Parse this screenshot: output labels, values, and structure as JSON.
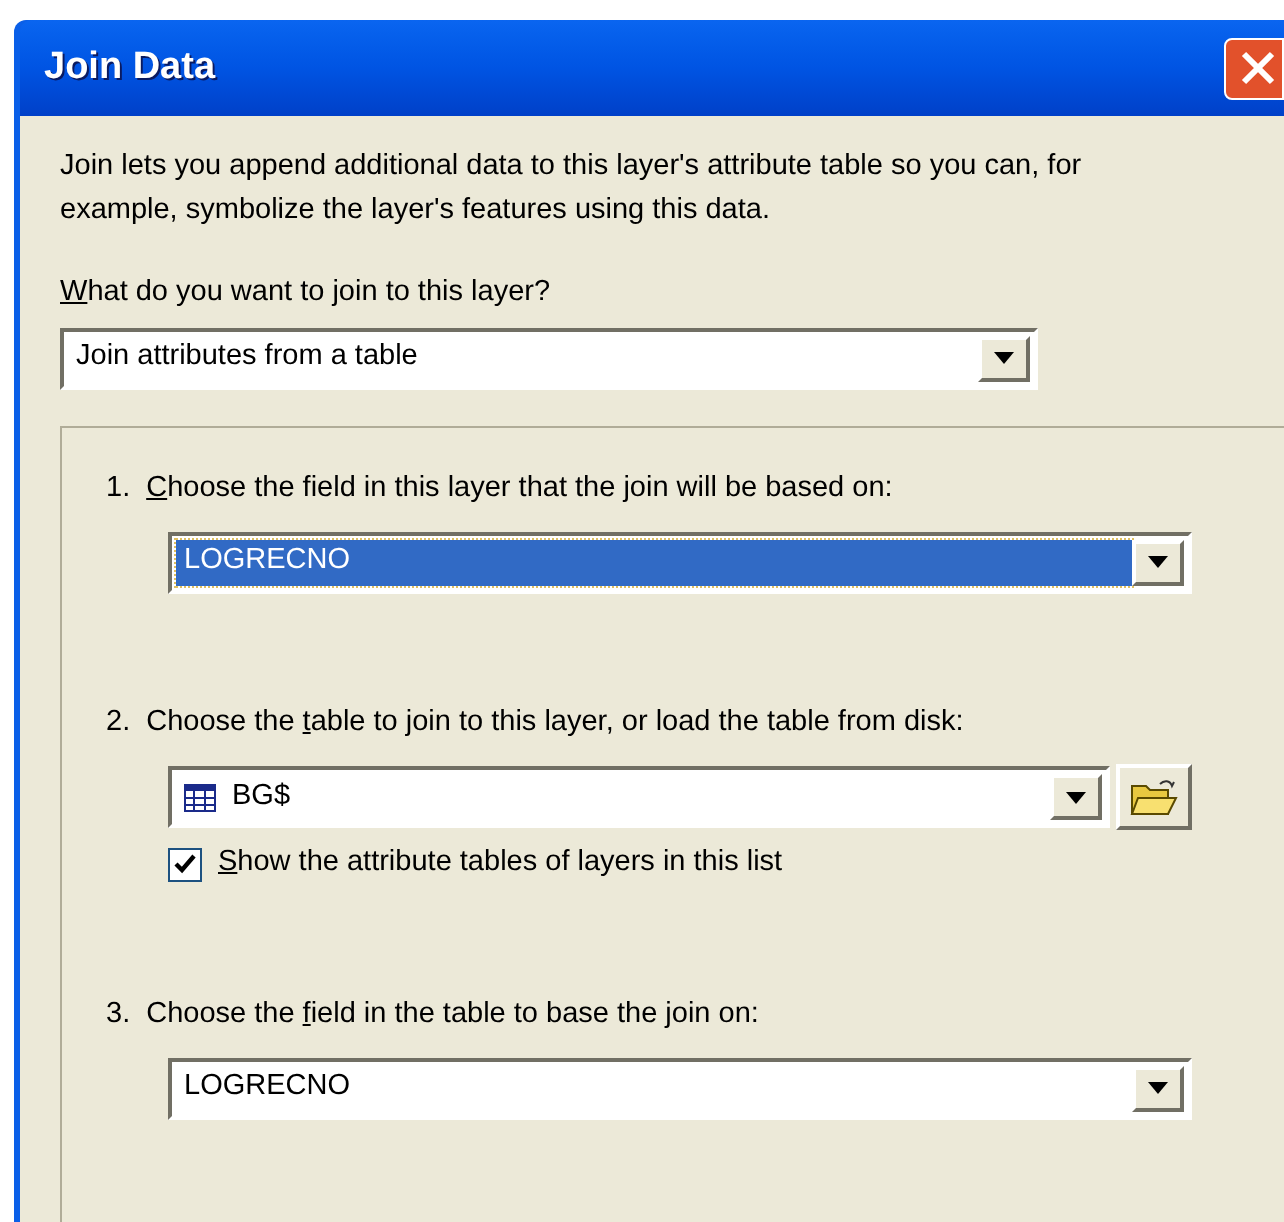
{
  "window": {
    "title": "Join Data"
  },
  "intro": "Join lets you append additional data to this layer's attribute table so you can, for example, symbolize the layer's features using this data.",
  "join_type": {
    "label": {
      "key": "W",
      "after": "hat do you want to join to this layer?"
    },
    "value": "Join attributes from a table"
  },
  "steps": [
    {
      "kind": "select",
      "number": "1.",
      "label": {
        "key": "C",
        "after": "hoose the field in this layer that the join will be based on:"
      },
      "value": "LOGRECNO",
      "focused": true
    },
    {
      "kind": "select",
      "number": "2.",
      "label": {
        "before": "Choose the ",
        "key": "t",
        "after": "able to join to this layer, or load the table from disk:"
      },
      "value": "BG$",
      "focused": false,
      "table_icon": true,
      "browse_button": true,
      "checkbox": {
        "label": {
          "key": "S",
          "after": "how the attribute tables of layers in this list"
        },
        "checked": true
      }
    },
    {
      "kind": "select",
      "number": "3.",
      "label": {
        "before": "Choose the ",
        "key": "f",
        "after": "ield in the table to base the join on:"
      },
      "value": "LOGRECNO",
      "focused": false
    }
  ]
}
